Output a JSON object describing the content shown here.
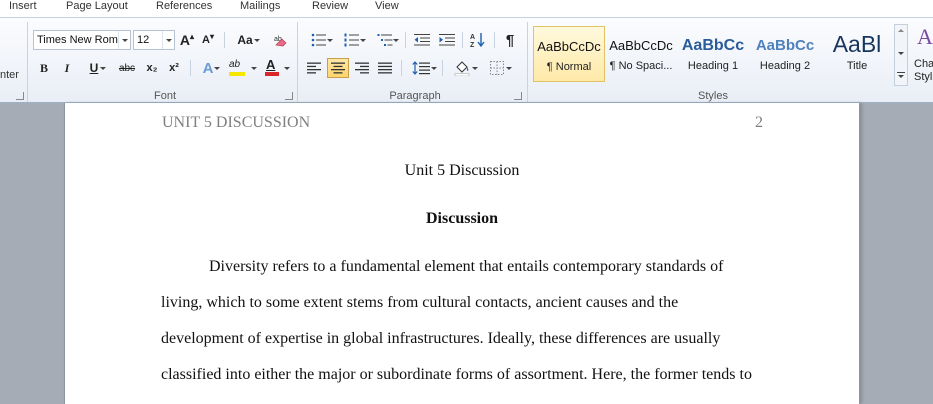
{
  "menu": {
    "tabs": [
      "Insert",
      "Page Layout",
      "References",
      "Mailings",
      "Review",
      "View"
    ]
  },
  "ribbon": {
    "clipboard_partial_label": "nter",
    "font": {
      "group_label": "Font",
      "font_name": "Times New Rom",
      "font_size": "12",
      "grow_font_glyph": "A",
      "shrink_font_glyph": "A",
      "change_case_glyph": "Aa",
      "bold_glyph": "B",
      "italic_glyph": "I",
      "underline_glyph": "U",
      "strikethrough_glyph": "abc",
      "subscript_glyph": "x₂",
      "superscript_glyph": "x²",
      "text_effects_glyph": "A",
      "highlight_glyph": "ab",
      "font_color_glyph": "A",
      "highlight_color": "#f5e700",
      "font_color": "#d9262b"
    },
    "paragraph": {
      "group_label": "Paragraph",
      "pilcrow_glyph": "¶"
    },
    "styles": {
      "group_label": "Styles",
      "tiles": [
        {
          "preview": "AaBbCcDc",
          "name": "¶ Normal",
          "selected": true
        },
        {
          "preview": "AaBbCcDc",
          "name": "¶ No Spaci...",
          "selected": false
        },
        {
          "preview": "AaBbCc",
          "name": "Heading 1",
          "selected": false
        },
        {
          "preview": "AaBbCc",
          "name": "Heading 2",
          "selected": false
        },
        {
          "preview": "AaBl",
          "name": "Title",
          "selected": false
        }
      ],
      "change_styles_label_1": "Cha",
      "change_styles_label_2": "Styl"
    }
  },
  "document": {
    "header_left": "UNIT 5 DISCUSSION",
    "header_right": "2",
    "title": "Unit 5 Discussion",
    "heading": "Discussion",
    "paragraph_lines": [
      "Diversity refers to a fundamental element that entails contemporary standards of",
      "living, which to some extent stems from cultural contacts, ancient causes and the",
      "development of expertise in global infrastructures. Ideally, these differences are usually",
      "classified into either the major or subordinate forms of assortment. Here, the former tends to"
    ]
  },
  "colors": {
    "heading1_preview": "#2a5b9a",
    "heading2_preview": "#4f81bd",
    "title_preview": "#17365d",
    "header_text": "#808080"
  }
}
